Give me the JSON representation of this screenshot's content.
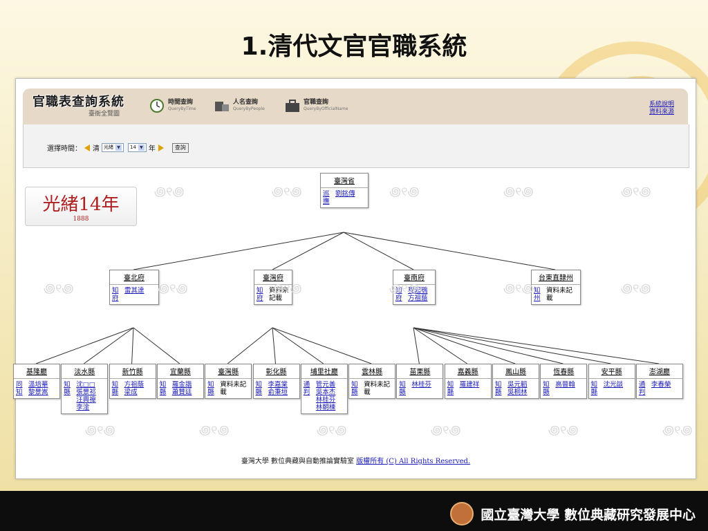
{
  "slide": {
    "title": "1.清代文官官職系統",
    "org": "國立臺灣大學 數位典藏研究發展中心"
  },
  "app": {
    "title": "官職表查詢系統",
    "subtitle": "臺衙全覽圖",
    "nav": [
      {
        "label": "時間查詢",
        "sub": "QueryByTime",
        "icon": "clock-icon"
      },
      {
        "label": "人名查詢",
        "sub": "QueryByPeople",
        "icon": "people-icon"
      },
      {
        "label": "官職查詢",
        "sub": "QueryByOfficialName",
        "icon": "briefcase-icon"
      }
    ],
    "links": [
      "系統說明",
      "資料來源"
    ]
  },
  "filter": {
    "label": "選擇時間：",
    "dynasty": "清",
    "era": "光緒",
    "year": "14",
    "year_unit": "年",
    "query": "查詢"
  },
  "year_display": {
    "main": "光緒14年",
    "sub": "1888"
  },
  "tree": {
    "province": {
      "name": "臺灣省",
      "office": "巡撫",
      "names": [
        "劉銘傳"
      ]
    },
    "prefectures": [
      {
        "name": "臺北府",
        "office": "知府",
        "names": [
          "雷其達"
        ],
        "plain": false
      },
      {
        "name": "臺灣府",
        "office": "知府",
        "names": [
          "資料未記載"
        ],
        "plain": true
      },
      {
        "name": "臺南府",
        "office": "知府",
        "names": [
          "程起鶚",
          "方祖蔭"
        ],
        "plain": false
      },
      {
        "name": "台東直隸州",
        "office": "知州",
        "names": [
          "資料未記載"
        ],
        "plain": true
      }
    ],
    "counties": [
      {
        "name": "基隆廳",
        "office": "同知",
        "names": [
          "溫培華",
          "黎景嵩"
        ],
        "plain": false
      },
      {
        "name": "淡水縣",
        "office": "知縣",
        "names": [
          "沈□□",
          "張景祁",
          "汪興禕",
          "李淦"
        ],
        "plain": false
      },
      {
        "name": "新竹縣",
        "office": "知縣",
        "names": [
          "方祖蔭",
          "梁成"
        ],
        "plain": false
      },
      {
        "name": "宜蘭縣",
        "office": "知縣",
        "names": [
          "羅金諧",
          "蕭贊廷"
        ],
        "plain": false
      },
      {
        "name": "臺灣縣",
        "office": "知縣",
        "names": [
          "資料未記載"
        ],
        "plain": true
      },
      {
        "name": "彰化縣",
        "office": "知縣",
        "names": [
          "李嘉棠",
          "俞秉垣"
        ],
        "plain": false
      },
      {
        "name": "埔里社廳",
        "office": "通判",
        "names": [
          "管元善",
          "吳本杰",
          "林桂芬",
          "林朝棟"
        ],
        "plain": false
      },
      {
        "name": "雲林縣",
        "office": "知縣",
        "names": [
          "資料未記載"
        ],
        "plain": true
      },
      {
        "name": "苗栗縣",
        "office": "知縣",
        "names": [
          "林桂芬"
        ],
        "plain": false
      },
      {
        "name": "嘉義縣",
        "office": "知縣",
        "names": [
          "羅建祥"
        ],
        "plain": false
      },
      {
        "name": "鳳山縣",
        "office": "知縣",
        "names": [
          "吳元韜",
          "吳桐林"
        ],
        "plain": false
      },
      {
        "name": "恆春縣",
        "office": "知縣",
        "names": [
          "高晉翰"
        ],
        "plain": false
      },
      {
        "name": "安平縣",
        "office": "知縣",
        "names": [
          "沈光燄"
        ],
        "plain": false
      },
      {
        "name": "澎湖廳",
        "office": "通判",
        "names": [
          "李春榮"
        ],
        "plain": false
      }
    ]
  },
  "footer": {
    "text": "臺灣大學 數位典藏與自動推論實驗室 ",
    "link": "版權所有 (C) All Rights Reserved."
  }
}
